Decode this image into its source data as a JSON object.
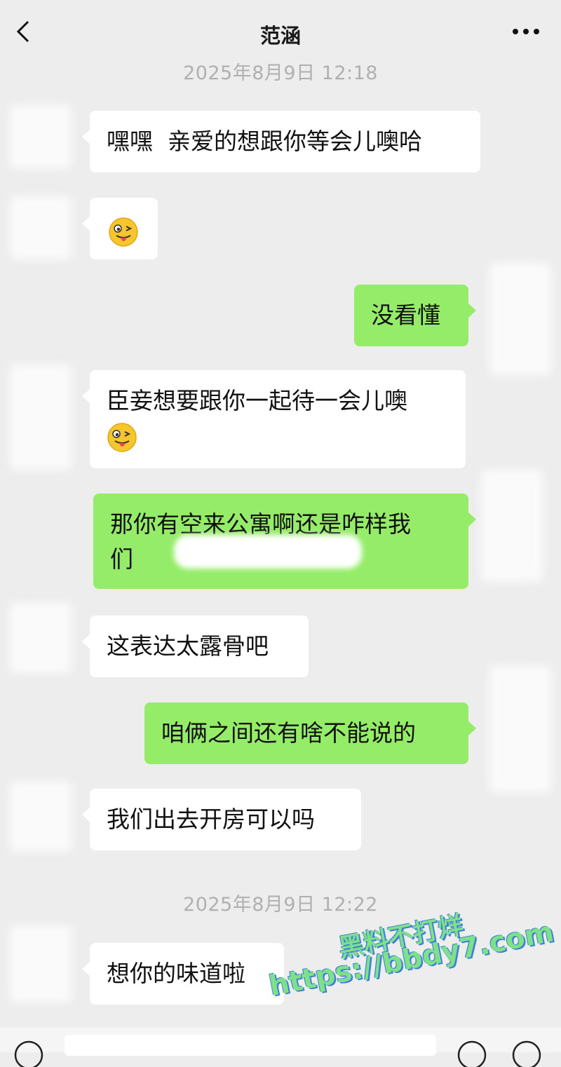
{
  "header": {
    "title": "范涵"
  },
  "messages": [
    {
      "type": "time",
      "text": "2025年8月9日 12:18"
    },
    {
      "side": "left",
      "text": "嘿嘿  亲爱的想跟你等会儿噢哈"
    },
    {
      "side": "left",
      "emoji": "wink-tongue"
    },
    {
      "side": "right",
      "text": "没看懂"
    },
    {
      "side": "left",
      "text": "臣妾想要跟你一起待一会儿噢",
      "emoji": "wink-tongue"
    },
    {
      "side": "right",
      "text": "那你有空来公寓啊还是咋样我",
      "text2": "们",
      "redacted": true
    },
    {
      "side": "left",
      "text": "这表达太露骨吧"
    },
    {
      "side": "right",
      "text": "咱俩之间还有啥不能说的"
    },
    {
      "side": "left",
      "text": "我们出去开房可以吗"
    },
    {
      "type": "time",
      "text": "2025年8月9日 12:22"
    },
    {
      "side": "left",
      "text": "想你的味道啦"
    }
  ],
  "watermark": {
    "line1": "黑料不打烊",
    "line2": "https://bbdy7.com"
  },
  "colors": {
    "background": "#ededed",
    "bubble_right": "#95ec69",
    "bubble_left": "#ffffff",
    "timestamp": "#b0b0b0"
  }
}
